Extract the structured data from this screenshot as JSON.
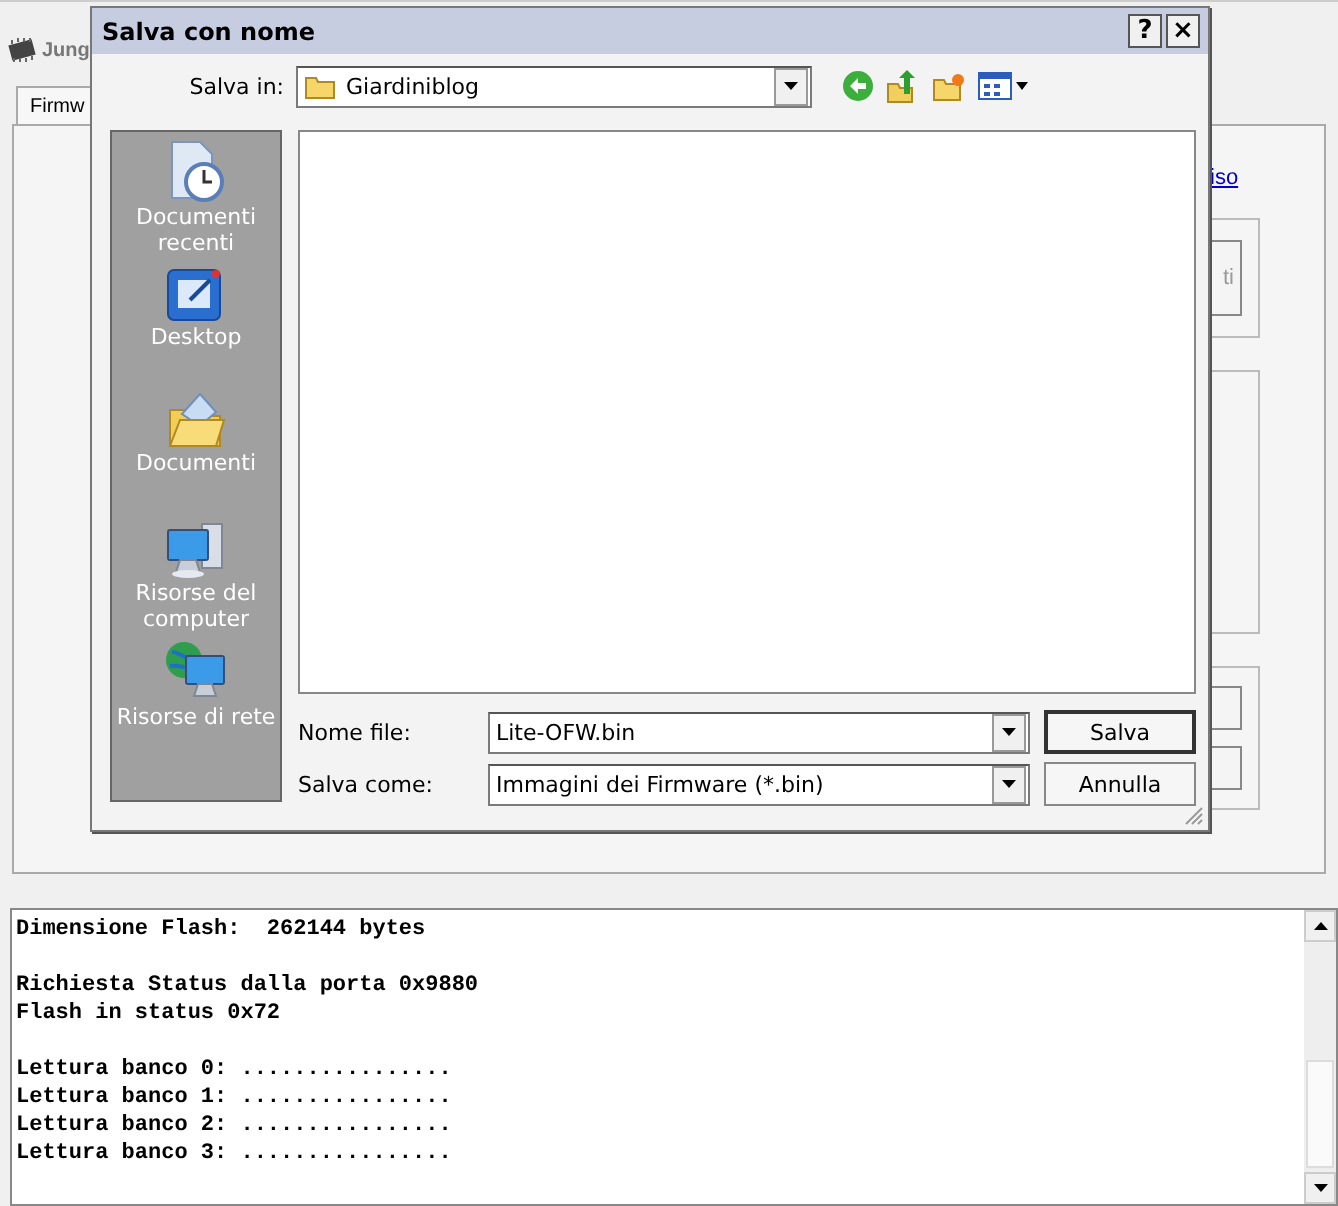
{
  "background_window": {
    "title": "Jung",
    "tab": "Firmw",
    "link": "iso",
    "button_text": "ti"
  },
  "dialog": {
    "title": "Salva con nome",
    "help_button": "?",
    "close_button": "×",
    "save_in": {
      "label": "Salva in:",
      "value": "Giardiniblog"
    },
    "places": [
      {
        "label": "Documenti recenti",
        "kind": "recent"
      },
      {
        "label": "Desktop",
        "kind": "desktop"
      },
      {
        "label": "Documenti",
        "kind": "documents"
      },
      {
        "label": "Risorse del computer",
        "kind": "computer"
      },
      {
        "label": "Risorse di rete",
        "kind": "network"
      }
    ],
    "file_name": {
      "label": "Nome file:",
      "value": "Lite-OFW.bin"
    },
    "save_as": {
      "label": "Salva come:",
      "value": "Immagini dei Firmware (*.bin)"
    },
    "buttons": [
      "Salva",
      "Annulla"
    ]
  },
  "log": {
    "blocks": [
      {
        "lines": [
          "Dimensione Flash:  262144 bytes"
        ]
      },
      {
        "lines": [
          "Richiesta Status dalla porta 0x9880",
          "Flash in status 0x72"
        ]
      },
      {
        "lines": [
          "Lettura banco 0: ................",
          "Lettura banco 1: ................",
          "Lettura banco 2: ................",
          "Lettura banco 3: ................"
        ]
      }
    ]
  }
}
